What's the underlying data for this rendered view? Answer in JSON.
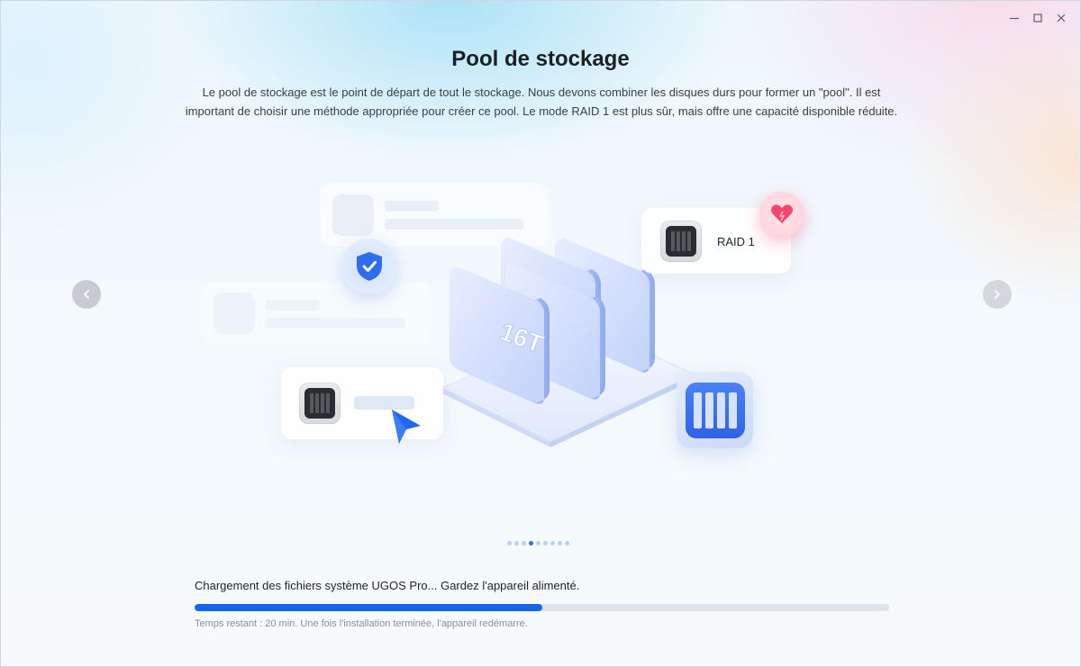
{
  "window": {
    "controls": [
      {
        "name": "minimize-button",
        "icon": "minimize-icon"
      },
      {
        "name": "maximize-button",
        "icon": "maximize-icon"
      },
      {
        "name": "close-button",
        "icon": "close-icon"
      }
    ]
  },
  "slide": {
    "title": "Pool de stockage",
    "description": "Le pool de stockage est le point de départ de tout le stockage. Nous devons combiner les disques durs pour former un \"pool\". Il est important de choisir une méthode appropriée pour créer ce pool. Le mode RAID 1 est plus sûr, mais offre une capacité disponible réduite.",
    "illustration": {
      "raid_card_label": "RAID 1",
      "drive_label": "16T"
    },
    "nav": {
      "prev_icon": "chevron-left-icon",
      "next_icon": "chevron-right-icon"
    },
    "pagination": {
      "total": 9,
      "active_index": 3
    }
  },
  "install": {
    "status": "Chargement des fichiers système UGOS Pro... Gardez l'appareil alimenté.",
    "progress_percent": 50,
    "remaining": "Temps restant : 20 min. Une fois l'installation terminée, l'appareil redémarre."
  },
  "colors": {
    "accent": "#1565f5",
    "dot_active": "#2f6fe8",
    "dot_inactive": "#b8d0ee",
    "heart": "#f5476e"
  }
}
